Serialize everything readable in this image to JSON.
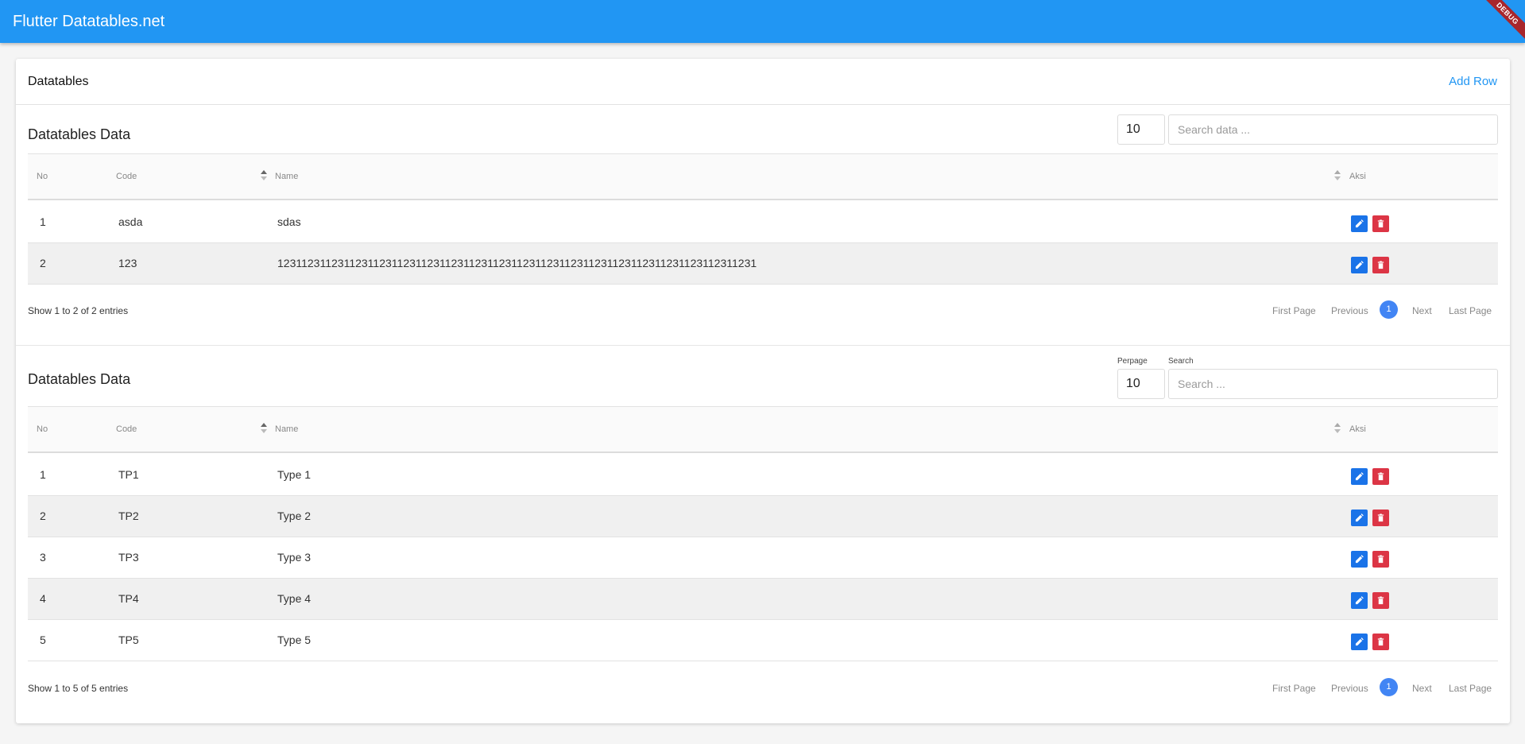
{
  "app": {
    "title": "Flutter Datatables.net",
    "debug_label": "DEBUG"
  },
  "card": {
    "title": "Datatables",
    "add_row_label": "Add Row"
  },
  "colors": {
    "primary": "#2196f3",
    "edit": "#1a73e8",
    "delete": "#dc3545",
    "page_active": "#4285f4"
  },
  "table1": {
    "title": "Datatables Data",
    "perpage_value": "10",
    "search_placeholder": "Search data ...",
    "columns": {
      "no": "No",
      "code": "Code",
      "name": "Name",
      "action": "Aksi"
    },
    "rows": [
      {
        "no": "1",
        "code": "asda",
        "name": "sdas"
      },
      {
        "no": "2",
        "code": "123",
        "name": "12311231123112311231123112311231123112311231123112311231123112311231123112311231"
      }
    ],
    "info": "Show 1 to 2 of 2 entries",
    "pagination": {
      "first": "First Page",
      "previous": "Previous",
      "current": "1",
      "next": "Next",
      "last": "Last Page"
    }
  },
  "table2": {
    "title": "Datatables Data",
    "perpage_label": "Perpage",
    "perpage_value": "10",
    "search_label": "Search",
    "search_placeholder": "Search ...",
    "columns": {
      "no": "No",
      "code": "Code",
      "name": "Name",
      "action": "Aksi"
    },
    "rows": [
      {
        "no": "1",
        "code": "TP1",
        "name": "Type 1"
      },
      {
        "no": "2",
        "code": "TP2",
        "name": "Type 2"
      },
      {
        "no": "3",
        "code": "TP3",
        "name": "Type 3"
      },
      {
        "no": "4",
        "code": "TP4",
        "name": "Type 4"
      },
      {
        "no": "5",
        "code": "TP5",
        "name": "Type 5"
      }
    ],
    "info": "Show 1 to 5 of 5 entries",
    "pagination": {
      "first": "First Page",
      "previous": "Previous",
      "current": "1",
      "next": "Next",
      "last": "Last Page"
    }
  }
}
